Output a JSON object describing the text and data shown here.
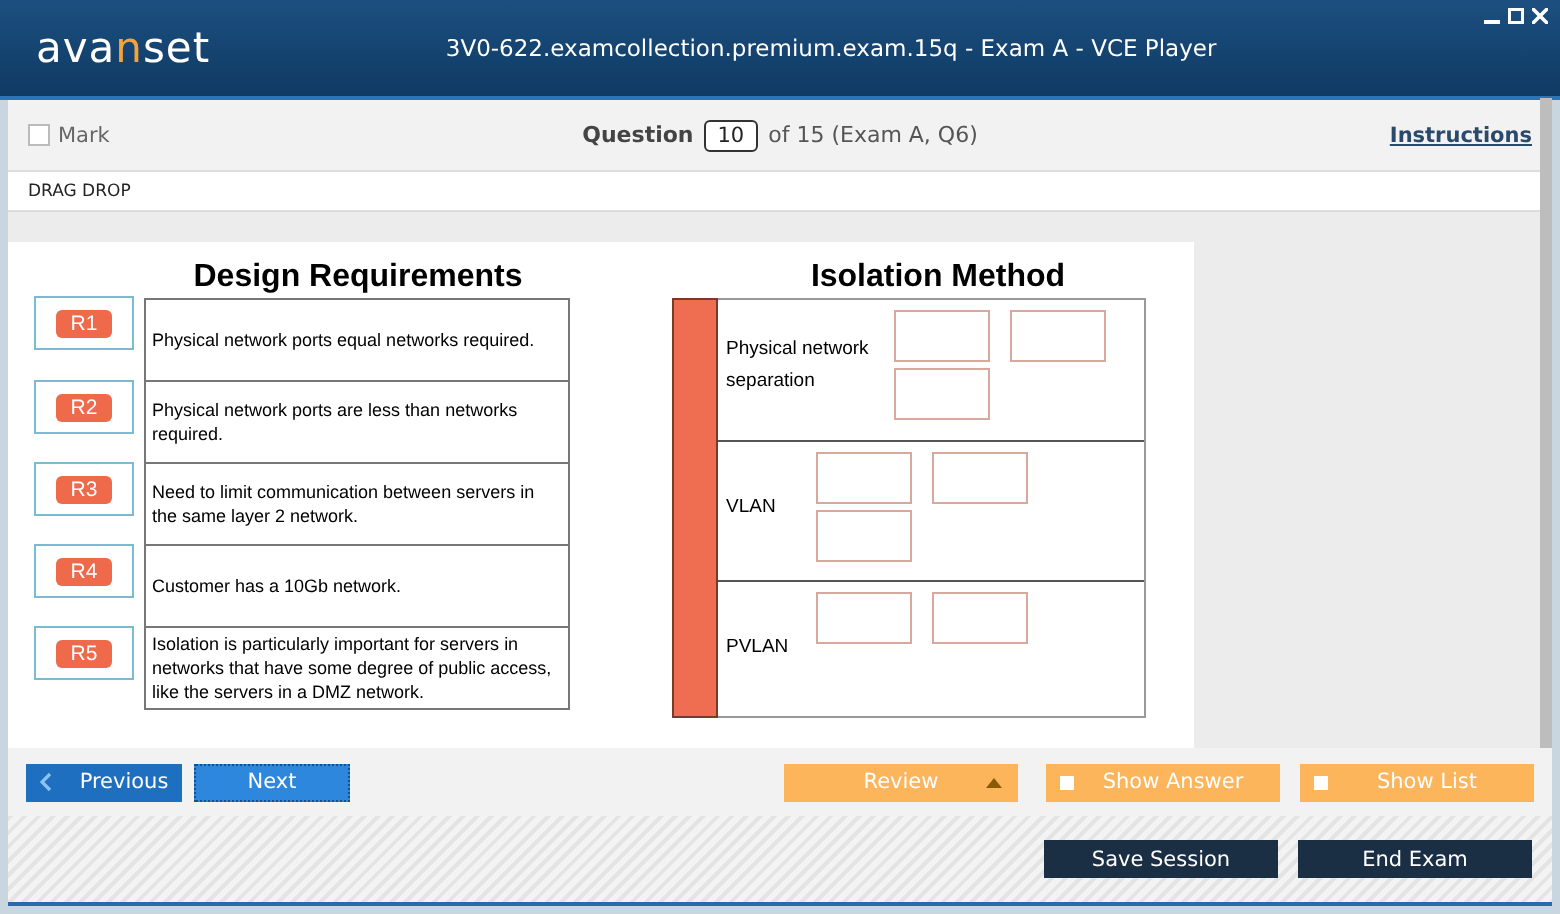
{
  "window": {
    "logo": [
      {
        "text": "ava",
        "accent": false
      },
      {
        "text": "n",
        "accent": true
      },
      {
        "text": "set",
        "accent": false
      }
    ],
    "title": "3V0-622.examcollection.premium.exam.15q - Exam A - VCE Player"
  },
  "toolbar": {
    "mark": {
      "label": "Mark",
      "checked": false
    },
    "question_label": "Question",
    "question_number": "10",
    "question_suffix": "of 15 (Exam A, Q6)",
    "instructions": "Instructions"
  },
  "question_type": "DRAG DROP",
  "exhibit": {
    "requirements": {
      "title": "Design Requirements",
      "items": [
        {
          "tag": "R1",
          "text": "Physical network ports equal networks required."
        },
        {
          "tag": "R2",
          "text": "Physical network ports are less than networks required."
        },
        {
          "tag": "R3",
          "text": "Need to limit communication between servers in the same layer 2 network."
        },
        {
          "tag": "R4",
          "text": "Customer has a 10Gb network."
        },
        {
          "tag": "R5",
          "text": "Isolation is particularly important for servers in networks that have some degree of public access, like the servers in a DMZ network."
        }
      ]
    },
    "isolation": {
      "title": "Isolation Method",
      "rows": [
        {
          "label": "Physical network separation",
          "slots": [
            {
              "filled": false
            },
            {
              "filled": false
            },
            {
              "filled": false
            }
          ]
        },
        {
          "label": "VLAN",
          "slots": [
            {
              "filled": false
            },
            {
              "filled": false
            },
            {
              "filled": false
            }
          ]
        },
        {
          "label": "PVLAN",
          "slots": [
            {
              "filled": false
            },
            {
              "filled": false
            }
          ]
        }
      ]
    }
  },
  "nav": [
    {
      "kind": "back",
      "label": "Previous",
      "focused": false
    },
    {
      "kind": "plain",
      "label": "Next",
      "focused": true
    },
    {
      "kind": "spacer"
    },
    {
      "kind": "menu",
      "label": "Review"
    },
    {
      "kind": "toggle",
      "label": "Show Answer",
      "checked": false
    },
    {
      "kind": "toggle",
      "label": "Show List",
      "checked": false
    }
  ],
  "actions": [
    "Save Session",
    "End Exam"
  ]
}
